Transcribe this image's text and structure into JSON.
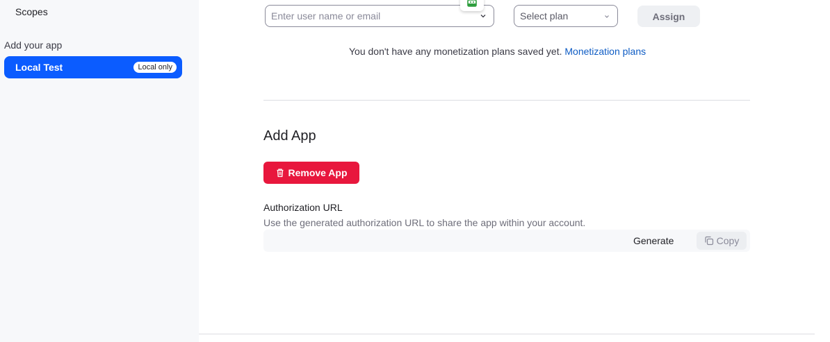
{
  "sidebar": {
    "scopes_label": "Scopes",
    "section_label": "Add your app",
    "active_item": {
      "label": "Local Test",
      "badge": "Local only"
    }
  },
  "assign_form": {
    "user_placeholder": "Enter user name or email",
    "plan_placeholder": "Select plan",
    "assign_label": "Assign"
  },
  "monetization": {
    "note": "You don't have any monetization plans saved yet.",
    "link_label": "Monetization plans"
  },
  "add_app": {
    "title": "Add App",
    "remove_label": "Remove App",
    "auth_label": "Authorization URL",
    "auth_description": "Use the generated authorization URL to share the app within your account.",
    "generate_label": "Generate",
    "copy_label": "Copy"
  },
  "icons": {
    "chevron": "chevron-down-icon",
    "trash": "trash-icon",
    "copy": "copy-icon",
    "floating": "calendar-icon"
  },
  "colors": {
    "primary": "#0b5cff",
    "danger": "#e8173d",
    "link": "#0e5cc4",
    "accent_green": "#2e9e3e"
  }
}
